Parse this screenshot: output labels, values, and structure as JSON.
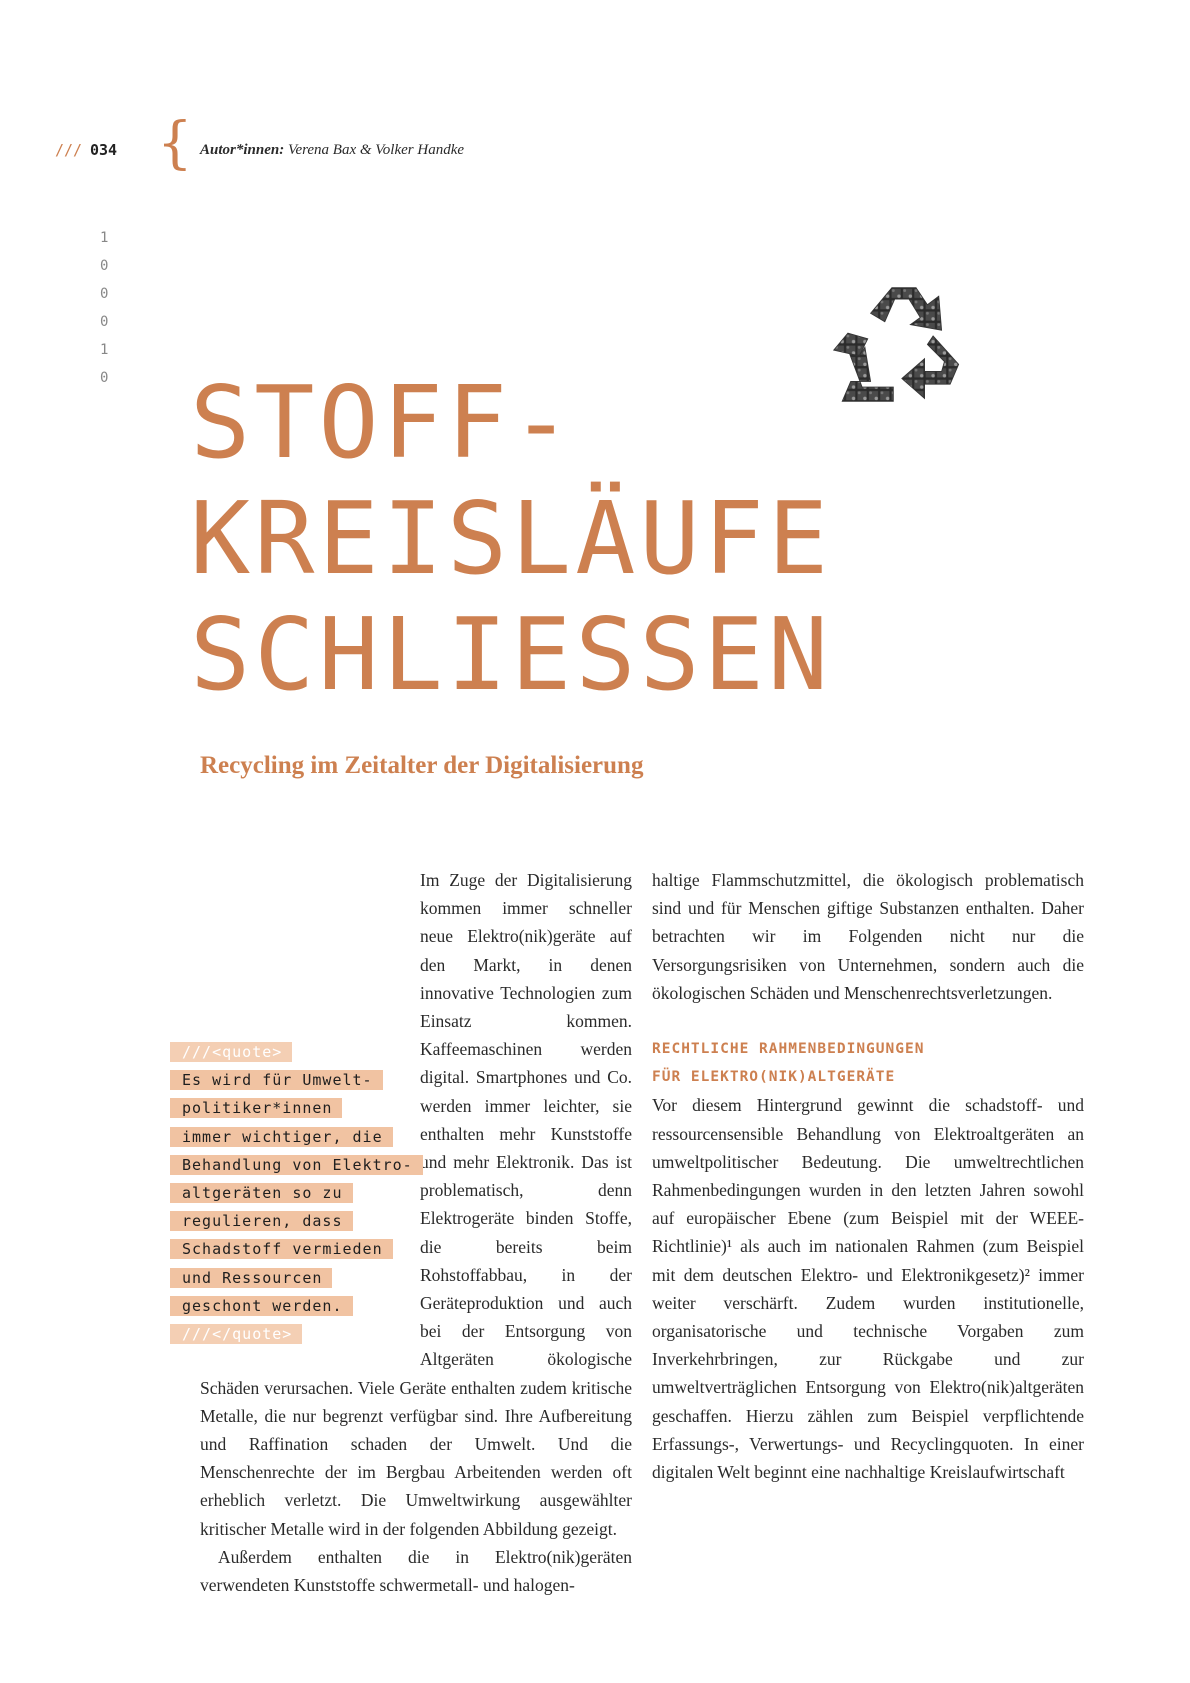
{
  "header": {
    "slashes": "///",
    "page_number": "034",
    "brace": "{",
    "author_label": "Autor*innen:",
    "author_names": "Verena Bax & Volker Handke"
  },
  "binary_digits": [
    "1",
    "0",
    "0",
    "0",
    "1",
    "0"
  ],
  "title_lines": [
    "STOFF-",
    "KREISLÄUFE",
    "SCHLIESSEN"
  ],
  "subtitle": "Recycling im Zeitalter der Digitalisierung",
  "colors": {
    "accent": "#cd8050",
    "quote_highlight": "#f1c3a2",
    "text": "#2a2a2a"
  },
  "icon": "recycle-icon",
  "quote": {
    "open_tag": "///<quote>",
    "lines": [
      "Es wird für Umwelt-",
      "politiker*innen",
      "immer wichtiger, die",
      "Behandlung von Elektro-",
      "altgeräten so zu",
      "regulieren, dass",
      "Schadstoff vermieden",
      "und Ressourcen",
      "geschont werden."
    ],
    "close_tag": "///</quote>"
  },
  "column1": {
    "para1": "Im Zuge der Digitalisierung kommen immer schneller neue Elektro(nik)geräte auf den Markt, in denen innovative Technologien zum Einsatz kommen. Kaffeemaschinen werden digital. Smartphones und Co. werden immer leichter, sie enthalten mehr Kunststoffe und mehr Elektronik. Das ist problematisch, denn Elektrogeräte binden Stoffe, die bereits beim Rohstoffabbau, in der Geräteproduktion und auch bei der Entsorgung von Altgeräten ökologische Schäden verursachen. Viele Geräte enthalten zudem kritische Metalle, die nur begrenzt verfügbar sind. Ihre Aufbereitung und Raffination schaden der Umwelt. Und die Menschenrechte der im Bergbau Arbeitenden werden oft erheblich verletzt. Die Umweltwirkung ausgewählter kritischer Metalle wird in der folgenden Abbildung gezeigt.",
    "para2": "Außerdem enthalten die in Elektro(nik)geräten verwendeten Kunststoffe schwermetall- und halogen-"
  },
  "column2": {
    "para1": "haltige Flammschutzmittel, die ökologisch problematisch sind und für Menschen giftige Substanzen enthalten. Daher betrachten wir im Folgenden nicht nur die Versorgungsrisiken von Unternehmen, sondern auch die ökologischen Schäden und Menschenrechtsverletzungen.",
    "heading_line1": "RECHTLICHE RAHMENBEDINGUNGEN",
    "heading_line2": "FÜR ELEKTRO(NIK)ALTGERÄTE",
    "para2": "Vor diesem Hintergrund gewinnt die schadstoff- und ressourcensensible Behandlung von Elektroaltgeräten an umweltpolitischer Bedeutung. Die umweltrechtlichen Rahmenbedingungen wurden in den letzten Jahren sowohl auf europäischer Ebene (zum Beispiel mit der WEEE-Richtlinie)¹ als auch im nationalen Rahmen (zum Beispiel mit dem deutschen Elektro- und Elektronikgesetz)² immer weiter verschärft. Zudem wurden institutionelle, organisatorische und technische Vorgaben zum Inverkehrbringen, zur Rückgabe und zur umweltverträglichen Entsorgung von Elektro(nik)altgeräten geschaffen. Hierzu zählen zum Beispiel verpflichtende Erfassungs-, Verwertungs- und Recyclingquoten. In einer digitalen Welt beginnt eine nachhaltige Kreislaufwirtschaft"
  }
}
